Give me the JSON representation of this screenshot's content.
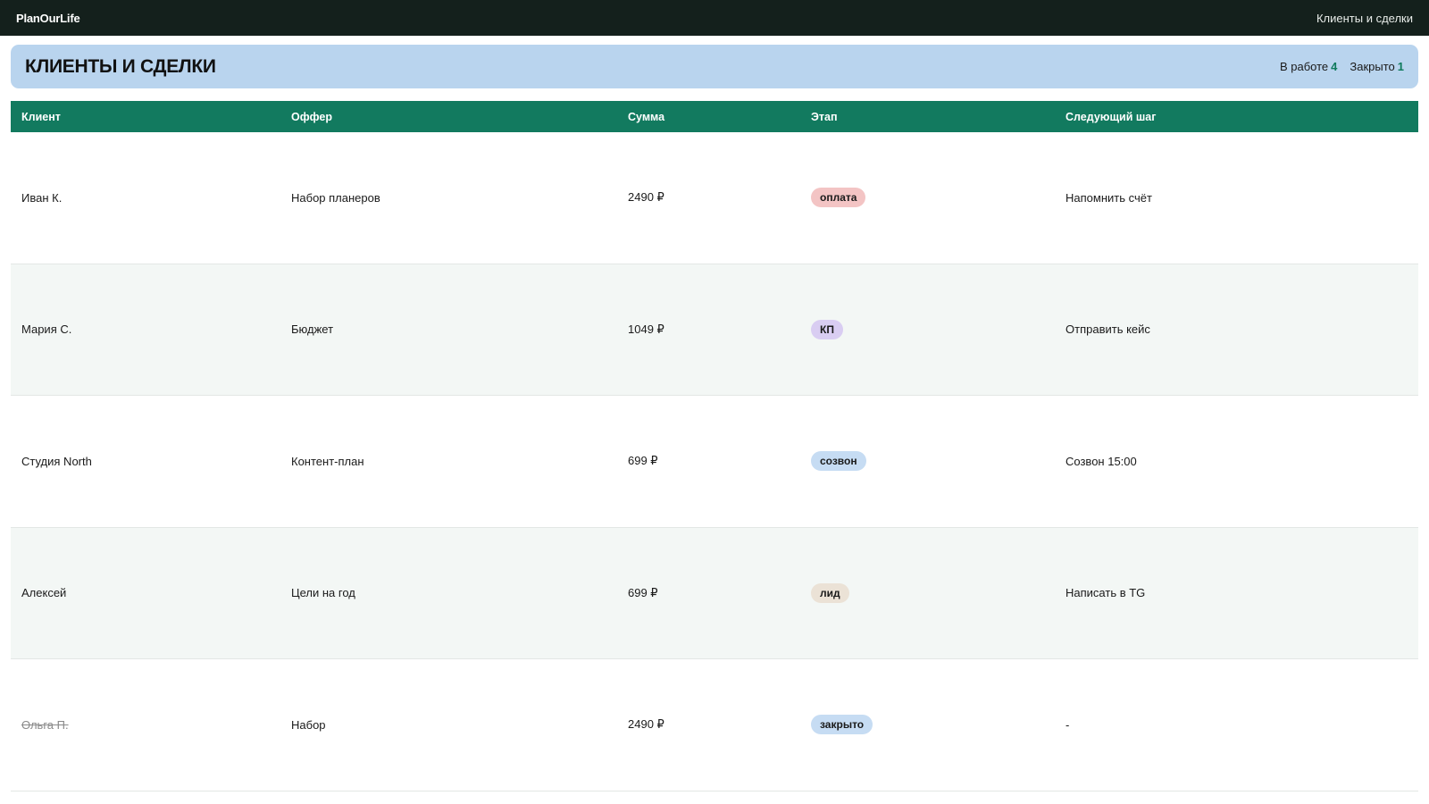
{
  "app": {
    "brand": "PlanOurLife",
    "nav_link": "Клиенты и сделки"
  },
  "header": {
    "title": "КЛИЕНТЫ И СДЕЛКИ",
    "stats": [
      {
        "label": "В работе",
        "value": "4"
      },
      {
        "label": "Закрыто",
        "value": "1"
      }
    ]
  },
  "table": {
    "columns": [
      "Клиент",
      "Оффер",
      "Сумма",
      "Этап",
      "Следующий шаг"
    ],
    "rows": [
      {
        "client": "Иван К.",
        "offer": "Набор планеров",
        "amount": "2490 ₽",
        "stage": "оплата",
        "next": "Напомнить счёт",
        "closed": false
      },
      {
        "client": "Мария С.",
        "offer": "Бюджет",
        "amount": "1049 ₽",
        "stage": "КП",
        "next": "Отправить кейс",
        "closed": false
      },
      {
        "client": "Студия North",
        "offer": "Контент-план",
        "amount": "699 ₽",
        "stage": "созвон",
        "next": "Созвон 15:00",
        "closed": false
      },
      {
        "client": "Алексей",
        "offer": "Цели на год",
        "amount": "699 ₽",
        "stage": "лид",
        "next": "Написать в TG",
        "closed": false
      },
      {
        "client": "Ольга П.",
        "offer": "Набор",
        "amount": "2490 ₽",
        "stage": "закрыто",
        "next": "-",
        "closed": true
      }
    ]
  },
  "colors": {
    "topbar": "#14201c",
    "hero": "#b9d4ee",
    "accent": "#127a5f",
    "stage_payment": "#f3c4c4",
    "stage_kp": "#d9cdf2",
    "stage_call": "#c6dcf3",
    "stage_lead": "#ebe2d6",
    "stage_closed": "#c6dcf3"
  }
}
